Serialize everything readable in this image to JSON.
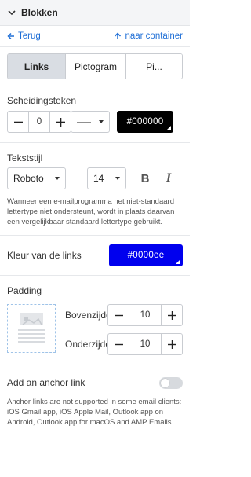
{
  "header": {
    "title": "Blokken"
  },
  "nav": {
    "back_label": "Terug",
    "to_container_label": "naar container"
  },
  "tabs": [
    {
      "label": "Links",
      "active": true
    },
    {
      "label": "Pictogram",
      "active": false
    },
    {
      "label": "Pi...",
      "active": false
    }
  ],
  "separator": {
    "label": "Scheidingsteken",
    "value": "0",
    "line_style": "——",
    "color": "#000000"
  },
  "text_style": {
    "label": "Tekststijl",
    "font": "Roboto",
    "size": "14",
    "bold_glyph": "B",
    "italic_glyph": "I",
    "note": "Wanneer een e-mailprogramma het niet-standaard lettertype niet ondersteunt, wordt in plaats daarvan een vergelijkbaar standaard lettertype gebruikt."
  },
  "link_color": {
    "label": "Kleur van de links",
    "value": "#0000ee",
    "swatch": "#0000ee"
  },
  "padding": {
    "label": "Padding",
    "top": {
      "label": "Bovenzijde",
      "value": "10"
    },
    "bottom": {
      "label": "Onderzijde",
      "value": "10"
    }
  },
  "anchor": {
    "label": "Add an anchor link",
    "enabled": false,
    "note": "Anchor links are not supported in some email clients: iOS Gmail app, iOS Apple Mail, Outlook app on Android, Outlook app for macOS and AMP Emails."
  },
  "colors": {
    "accent": "#1f6fd6",
    "active_tab": "#d9dde3"
  }
}
